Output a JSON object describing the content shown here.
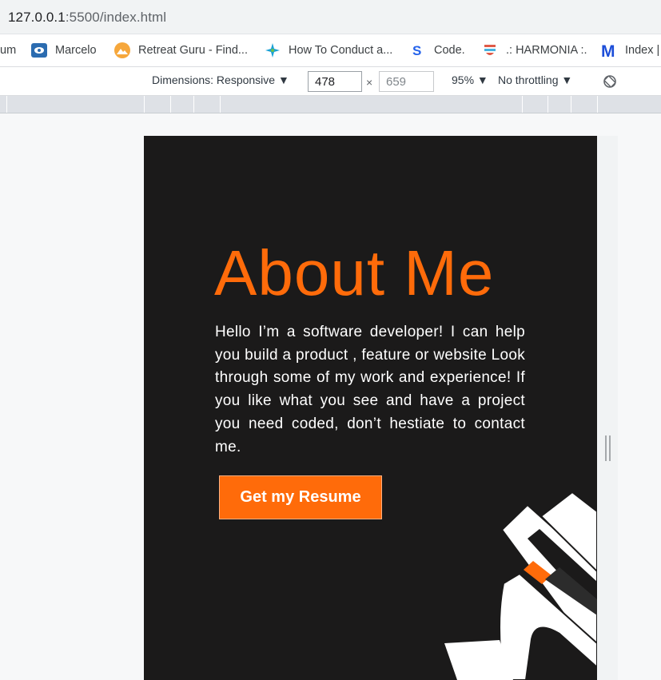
{
  "address": {
    "host": "127.0.0.1",
    "rest": ":5500/index.html"
  },
  "bookmarks": [
    {
      "label": "um",
      "icon": "bookmark-fragment"
    },
    {
      "label": "Marcelo",
      "icon": "cloud-icon"
    },
    {
      "label": "Retreat Guru - Find...",
      "icon": "mountain-icon"
    },
    {
      "label": "How To Conduct a...",
      "icon": "star-logo-icon"
    },
    {
      "label": "Code.",
      "icon": "s-logo-icon"
    },
    {
      "label": ".: HARMONIA :.",
      "icon": "harmonia-icon"
    },
    {
      "label": "Index |",
      "icon": "m-logo-icon"
    }
  ],
  "devtools": {
    "dimensions_label": "Dimensions: Responsive ▼",
    "width": "478",
    "times": "×",
    "height": "659",
    "zoom": "95% ▼",
    "throttling": "No throttling ▼"
  },
  "page": {
    "title": "About Me",
    "bio": "Hello I’m a software developer! I can help you build a product , feature or website Look through some of my work and experience! If you like what you see and have a project you need coded, don’t hestiate to contact me.",
    "resume_button": "Get my Resume",
    "accent_color": "#ff6b0a",
    "background_color": "#1b1a1a"
  }
}
